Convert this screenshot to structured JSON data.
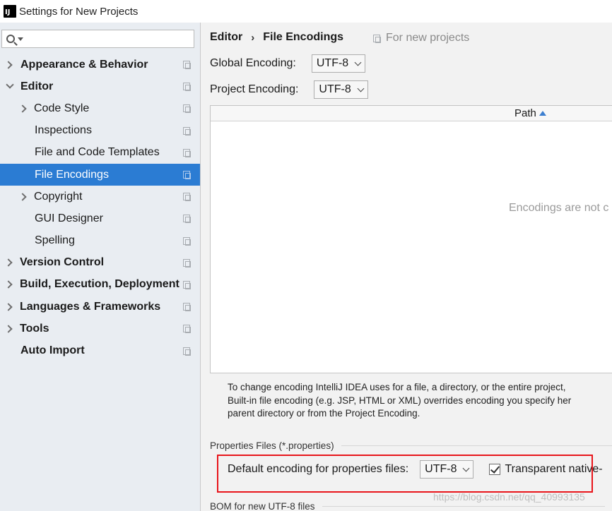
{
  "window": {
    "title": "Settings for New Projects"
  },
  "search": {
    "placeholder": ""
  },
  "sidebar": {
    "items": [
      {
        "label": "Appearance & Behavior"
      },
      {
        "label": "Editor"
      },
      {
        "label": "Code Style"
      },
      {
        "label": "Inspections"
      },
      {
        "label": "File and Code Templates"
      },
      {
        "label": "File Encodings"
      },
      {
        "label": "Copyright"
      },
      {
        "label": "GUI Designer"
      },
      {
        "label": "Spelling"
      },
      {
        "label": "Version Control"
      },
      {
        "label": "Build, Execution, Deployment"
      },
      {
        "label": "Languages & Frameworks"
      },
      {
        "label": "Tools"
      },
      {
        "label": "Auto Import"
      }
    ]
  },
  "breadcrumb": {
    "parent": "Editor",
    "separator": "›",
    "current": "File Encodings"
  },
  "scope_hint": "For new projects",
  "global_encoding": {
    "label": "Global Encoding:",
    "value": "UTF-8"
  },
  "project_encoding": {
    "label": "Project Encoding:",
    "value": "UTF-8"
  },
  "table": {
    "column_path": "Path",
    "empty_text": "Encodings are not c"
  },
  "info": {
    "line1": "To change encoding IntelliJ IDEA uses for a file, a directory, or the entire project,",
    "line2": "Built-in file encoding (e.g. JSP, HTML or XML) overrides encoding you specify her",
    "line3": "parent directory or from the Project Encoding."
  },
  "properties_section": {
    "title": "Properties Files (*.properties)"
  },
  "properties": {
    "label": "Default encoding for properties files:",
    "value": "UTF-8",
    "checkbox_label": "Transparent native-",
    "checkbox_checked": true
  },
  "bom_section": {
    "title": "BOM for new UTF-8 files"
  },
  "watermark": "https://blog.csdn.net/qq_40993135",
  "colors": {
    "selection": "#2b7cd3",
    "highlight_box": "#e8151b",
    "sidebar_bg": "#e9edf2"
  }
}
